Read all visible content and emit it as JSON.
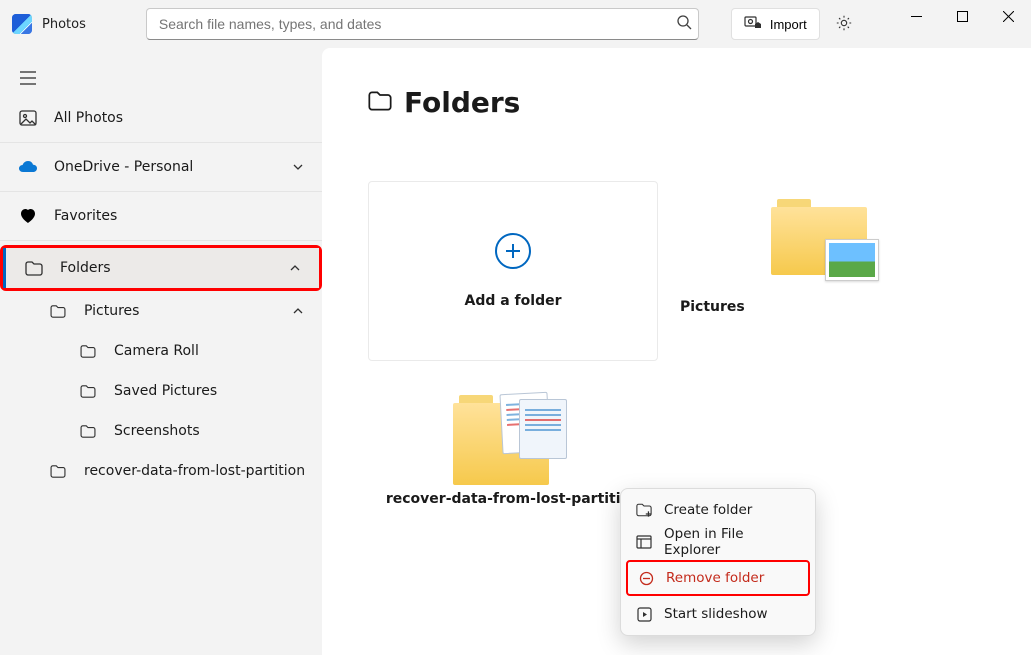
{
  "app": {
    "title": "Photos"
  },
  "search": {
    "placeholder": "Search file names, types, and dates"
  },
  "toolbar": {
    "import_label": "Import"
  },
  "sidebar": {
    "all_photos": "All Photos",
    "onedrive": "OneDrive - Personal",
    "favorites": "Favorites",
    "folders": "Folders",
    "pictures": "Pictures",
    "camera_roll": "Camera Roll",
    "saved_pictures": "Saved Pictures",
    "screenshots": "Screenshots",
    "recover": "recover-data-from-lost-partition"
  },
  "page": {
    "title": "Folders",
    "add_folder": "Add a folder",
    "pictures_label": "Pictures",
    "recover_label": "recover-data-from-lost-partition"
  },
  "context": {
    "create": "Create folder",
    "open": "Open in File Explorer",
    "remove": "Remove folder",
    "slideshow": "Start slideshow"
  }
}
